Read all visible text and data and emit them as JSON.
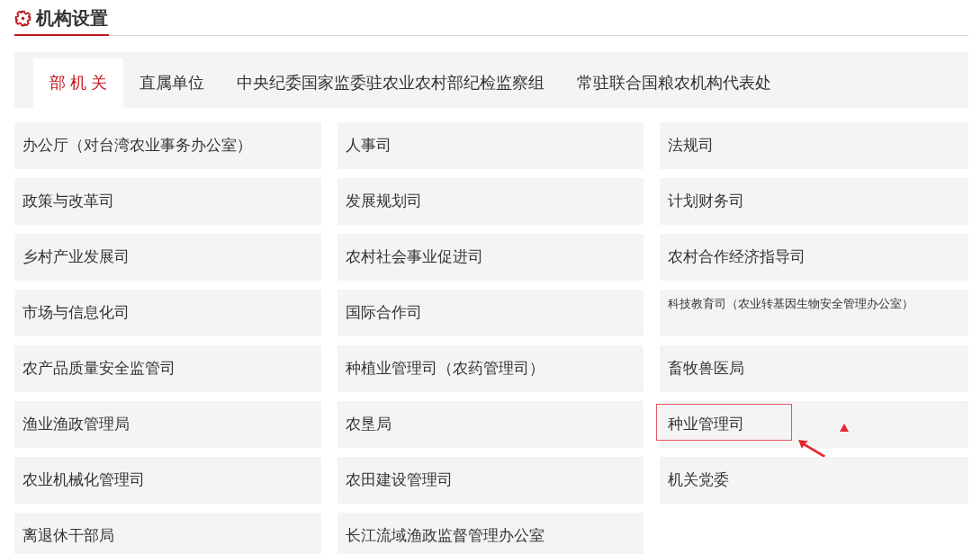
{
  "section": {
    "title": "机构设置"
  },
  "tabs": [
    {
      "label": "部 机 关",
      "selected": true
    },
    {
      "label": "直属单位",
      "selected": false
    },
    {
      "label": "中央纪委国家监委驻农业农村部纪检监察组",
      "selected": false
    },
    {
      "label": "常驻联合国粮农机构代表处",
      "selected": false
    }
  ],
  "departments": [
    {
      "name": "办公厅（对台湾农业事务办公室）",
      "kind": "standard",
      "highlighted": false
    },
    {
      "name": "人事司",
      "kind": "standard",
      "highlighted": false
    },
    {
      "name": "法规司",
      "kind": "standard",
      "highlighted": false
    },
    {
      "name": "政策与改革司",
      "kind": "standard",
      "highlighted": false
    },
    {
      "name": "发展规划司",
      "kind": "standard",
      "highlighted": false
    },
    {
      "name": "计划财务司",
      "kind": "standard",
      "highlighted": false
    },
    {
      "name": "乡村产业发展司",
      "kind": "standard",
      "highlighted": false
    },
    {
      "name": "农村社会事业促进司",
      "kind": "standard",
      "highlighted": false
    },
    {
      "name": "农村合作经济指导司",
      "kind": "standard",
      "highlighted": false
    },
    {
      "name": "市场与信息化司",
      "kind": "standard",
      "highlighted": false
    },
    {
      "name": "国际合作司",
      "kind": "standard",
      "highlighted": false
    },
    {
      "name": "科技教育司（农业转基因生物安全管理办公室）",
      "kind": "compact",
      "highlighted": false
    },
    {
      "name": "农产品质量安全监管司",
      "kind": "standard",
      "highlighted": false
    },
    {
      "name": "种植业管理司（农药管理司）",
      "kind": "standard",
      "highlighted": false
    },
    {
      "name": "畜牧兽医局",
      "kind": "standard",
      "highlighted": false
    },
    {
      "name": "渔业渔政管理局",
      "kind": "standard",
      "highlighted": false
    },
    {
      "name": "农垦局",
      "kind": "standard",
      "highlighted": false
    },
    {
      "name": "种业管理司",
      "kind": "standard",
      "highlighted": true
    },
    {
      "name": "农业机械化管理司",
      "kind": "standard",
      "highlighted": false
    },
    {
      "name": "农田建设管理司",
      "kind": "standard",
      "highlighted": false
    },
    {
      "name": "机关党委",
      "kind": "standard",
      "highlighted": false
    },
    {
      "name": "离退休干部局",
      "kind": "standard",
      "highlighted": false
    },
    {
      "name": "长江流域渔政监督管理办公室",
      "kind": "standard",
      "highlighted": false
    }
  ]
}
